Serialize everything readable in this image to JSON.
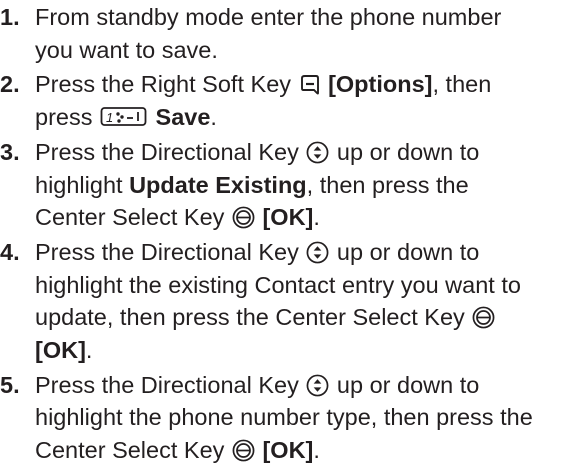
{
  "steps": [
    {
      "number": "1.",
      "lines": [
        "From standby mode enter the phone number",
        "you want to save."
      ]
    },
    {
      "number": "2.",
      "l1_a": "Press the Right Soft Key",
      "l1_b": "[Options]",
      "l1_c": ", then",
      "l2_a": "press",
      "key_label": "1",
      "l2_b": "Save",
      "l2_c": "."
    },
    {
      "number": "3.",
      "l1_a": "Press the Directional Key",
      "l1_b": "up or down to",
      "l2_a": "highlight",
      "l2_b": "Update Existing",
      "l2_c": ", then press the",
      "l3_a": "Center Select Key",
      "l3_b": "[OK]",
      "l3_c": "."
    },
    {
      "number": "4.",
      "l1_a": "Press the Directional Key",
      "l1_b": "up or down to",
      "l2": "highlight the existing Contact entry you want to",
      "l3": "update, then press the Center Select Key",
      "l4_a": "[OK]",
      "l4_b": "."
    },
    {
      "number": "5.",
      "l1_a": "Press the Directional Key",
      "l1_b": "up or down to",
      "l2": "highlight the phone number type, then press the",
      "l3_a": "Center Select Key",
      "l3_b": "[OK]",
      "l3_c": "."
    }
  ]
}
